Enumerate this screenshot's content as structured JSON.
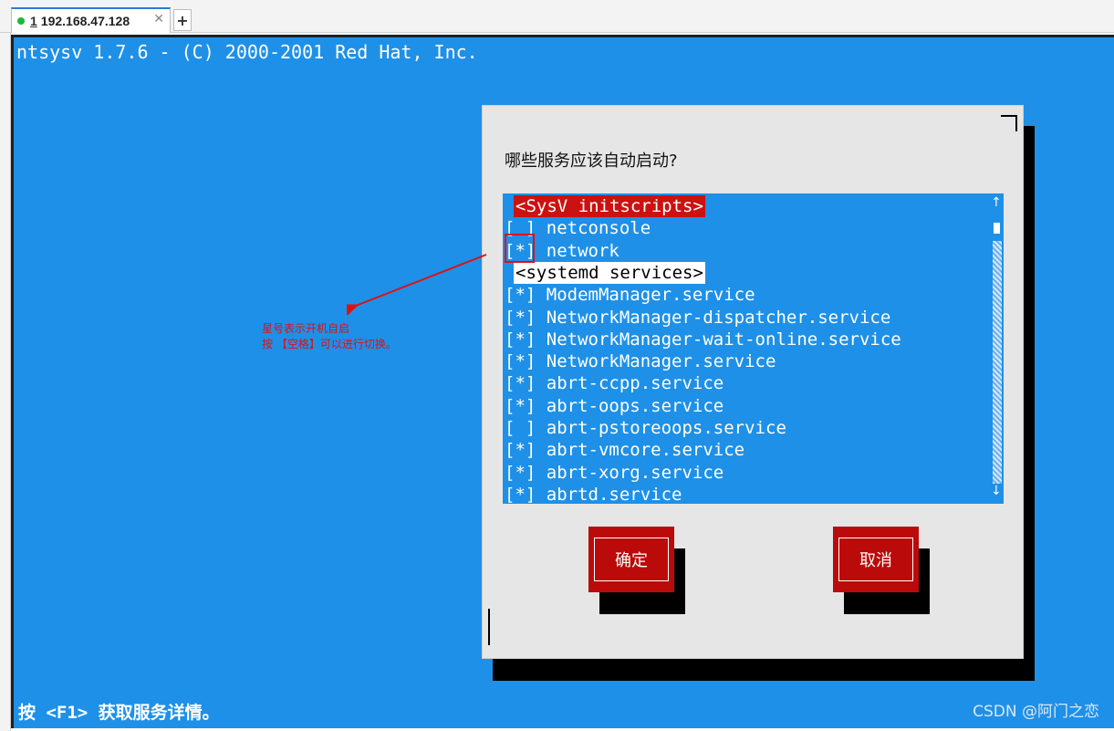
{
  "tab": {
    "index": "1",
    "label": "192.168.47.128",
    "close": "✕",
    "add": "+"
  },
  "terminal": {
    "title": "ntsysv 1.7.6 - (C) 2000-2001 Red Hat, Inc.",
    "hint": "按 <F1> 获取服务详情。"
  },
  "dialog": {
    "question": "哪些服务应该自动启动?",
    "list": [
      {
        "type": "heading",
        "style": "red",
        "text": "<SysV initscripts>"
      },
      {
        "type": "item",
        "checked": "[ ]",
        "name": "netconsole"
      },
      {
        "type": "item",
        "checked": "[*]",
        "name": "network"
      },
      {
        "type": "heading",
        "style": "white",
        "text": "<systemd services>"
      },
      {
        "type": "item",
        "checked": "[*]",
        "name": "ModemManager.service"
      },
      {
        "type": "item",
        "checked": "[*]",
        "name": "NetworkManager-dispatcher.service"
      },
      {
        "type": "item",
        "checked": "[*]",
        "name": "NetworkManager-wait-online.service"
      },
      {
        "type": "item",
        "checked": "[*]",
        "name": "NetworkManager.service"
      },
      {
        "type": "item",
        "checked": "[*]",
        "name": "abrt-ccpp.service"
      },
      {
        "type": "item",
        "checked": "[*]",
        "name": "abrt-oops.service"
      },
      {
        "type": "item",
        "checked": "[ ]",
        "name": "abrt-pstoreoops.service"
      },
      {
        "type": "item",
        "checked": "[*]",
        "name": "abrt-vmcore.service"
      },
      {
        "type": "item",
        "checked": "[*]",
        "name": "abrt-xorg.service"
      },
      {
        "type": "item",
        "checked": "[*]",
        "name": "abrtd.service"
      }
    ],
    "scroll_up": "↑",
    "scroll_down": "↓",
    "ok_label": "确定",
    "cancel_label": "取消"
  },
  "annotation": {
    "line1": "星号表示开机自启",
    "line2": "按 【空格】可以进行切换。",
    "color": "#e01010"
  },
  "watermark": "CSDN @阿门之恋",
  "colors": {
    "terminal_bg": "#1e90e8",
    "dialog_bg": "#e6e6e6",
    "button_red": "#bb0a0a",
    "heading_red": "#cc1111"
  }
}
